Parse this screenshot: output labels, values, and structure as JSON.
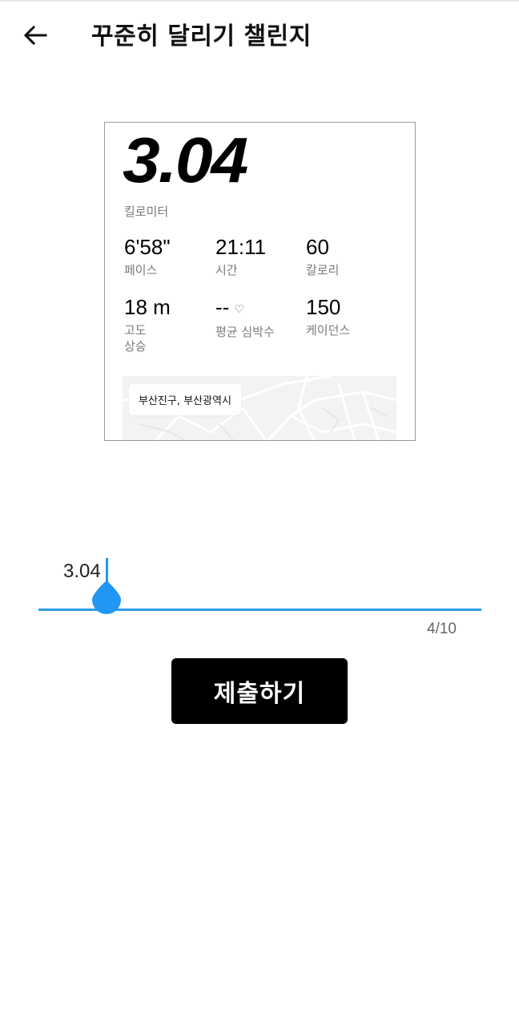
{
  "header": {
    "title": "꾸준히 달리기 챌린지",
    "back_icon": "arrow-left-icon"
  },
  "run_card": {
    "distance": "3.04",
    "distance_unit": "킬로미터",
    "stats": [
      {
        "value": "6'58\"",
        "label": "페이스"
      },
      {
        "value": "21:11",
        "label": "시간"
      },
      {
        "value": "60",
        "label": "칼로리"
      },
      {
        "value": "18 m",
        "label": "고도\n상승"
      },
      {
        "value": "--",
        "label": "평균 심박수",
        "icon": "heart-outline-icon"
      },
      {
        "value": "150",
        "label": "케이던스"
      }
    ],
    "location": "부산진구, 부산광역시"
  },
  "input": {
    "value": "3.04",
    "char_count": "4/10",
    "accent_color": "#2196f3"
  },
  "submit": {
    "label": "제출하기"
  }
}
